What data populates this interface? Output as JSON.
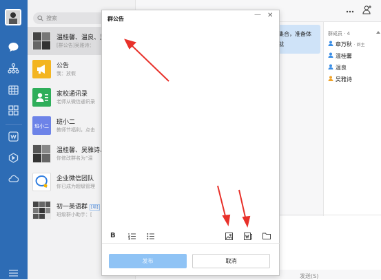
{
  "search": {
    "placeholder": "搜索"
  },
  "conversations": [
    {
      "title": "温桂馨、温良、吴",
      "subtitle": "[群公告]吴雅诗："
    },
    {
      "title": "公告",
      "subtitle": "我：放假"
    },
    {
      "title": "家校通讯录",
      "subtitle": "老师从微信通讯录"
    },
    {
      "title": "班小二",
      "subtitle": "教师节福利，点击"
    },
    {
      "title": "温桂馨、吴雅诗、",
      "subtitle": "你修改群名为“温"
    },
    {
      "title": "企业微信团队",
      "subtitle": "你已成为超级管理"
    },
    {
      "title": "初一英语群",
      "badge": "[培]",
      "subtitle": "班级群小助手：["
    }
  ],
  "chat": {
    "bubble_text": [
      "集合，准备体",
      "就"
    ],
    "members_title": "群成员 · 4",
    "members": [
      {
        "name": "章万秋",
        "tag": "· 群主"
      },
      {
        "name": "温桂馨",
        "tag": ""
      },
      {
        "name": "温良",
        "tag": ""
      },
      {
        "name": "吴雅诗",
        "tag": ""
      }
    ],
    "send_label": "发送(S)"
  },
  "dialog": {
    "title": "群公告",
    "minimize": "—",
    "close": "✕",
    "publish_label": "发布",
    "cancel_label": "取消",
    "bold_label": "B"
  },
  "colors": {
    "nav_blue": "#2d6cb5",
    "publish_disabled": "#8fc3f5",
    "arrow_red": "#e8312a"
  }
}
